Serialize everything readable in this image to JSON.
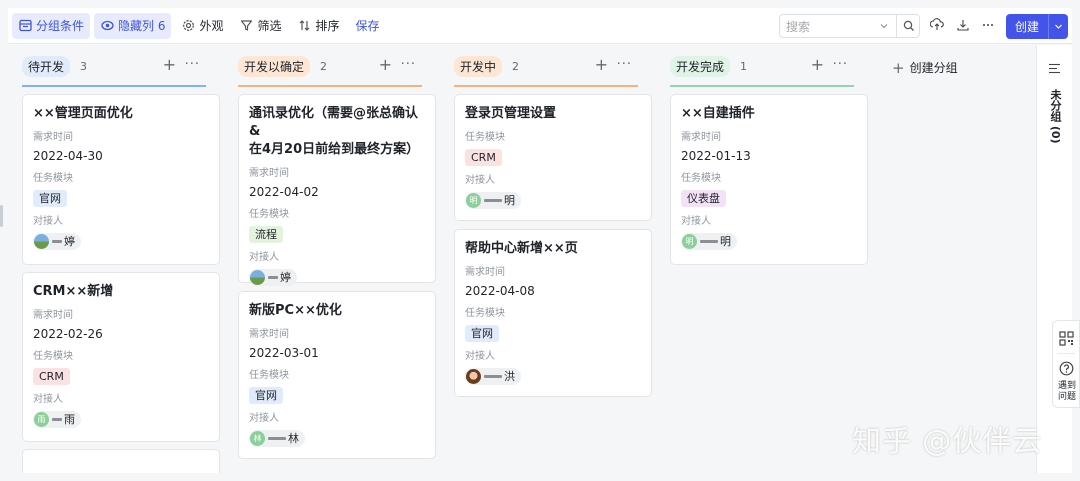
{
  "toolbar": {
    "group_label": "分组条件",
    "hidden_label": "隐藏列 6",
    "appearance_label": "外观",
    "filter_label": "筛选",
    "sort_label": "排序",
    "save_label": "保存",
    "search_placeholder": "搜索",
    "create_label": "创建"
  },
  "field_labels": {
    "time": "需求时间",
    "module": "任务模块",
    "owner": "对接人"
  },
  "new_group_label": "创建分组",
  "columns": [
    {
      "title": "待开发",
      "count": "3",
      "color": "#4e83fd",
      "tag_bg": "#e1ebfb",
      "cards": [
        {
          "title": "××管理页面优化",
          "date": "2022-04-30",
          "module": "官网",
          "owner": "婷"
        },
        {
          "title": "CRM××新增",
          "date": "2022-02-26",
          "module": "CRM",
          "owner": "雨",
          "avatar": "雨"
        }
      ]
    },
    {
      "title": "开发以确定",
      "count": "2",
      "color": "#f5a25c",
      "tag_bg": "#fde6d4",
      "cards": [
        {
          "title_line1": "通讯录优化（需要@张总确认 &",
          "title_line2": "在4月20日前给到最终方案）",
          "date": "2022-04-02",
          "module": "流程",
          "owner": "婷"
        },
        {
          "title": "新版PC××优化",
          "date": "2022-03-01",
          "module": "官网",
          "owner": "林",
          "avatar": "林"
        }
      ]
    },
    {
      "title": "开发中",
      "count": "2",
      "color": "#f5a25c",
      "tag_bg": "#fde6d4",
      "cards": [
        {
          "title": "登录页管理设置",
          "module": "CRM",
          "owner": "明",
          "avatar": "明"
        },
        {
          "title": "帮助中心新增××页",
          "date": "2022-04-08",
          "module": "官网",
          "owner": "洪"
        }
      ]
    },
    {
      "title": "开发完成",
      "count": "1",
      "color": "#7ecfa2",
      "tag_bg": "#dff3e6",
      "cards": [
        {
          "title": "××自建插件",
          "date": "2022-01-13",
          "module": "仪表盘",
          "owner": "明",
          "avatar": "明"
        }
      ]
    }
  ],
  "side_panel": {
    "ungrouped_label": "未分组 (0)",
    "help_label": "遇到问题"
  },
  "watermark": "知乎 @伙伴云"
}
